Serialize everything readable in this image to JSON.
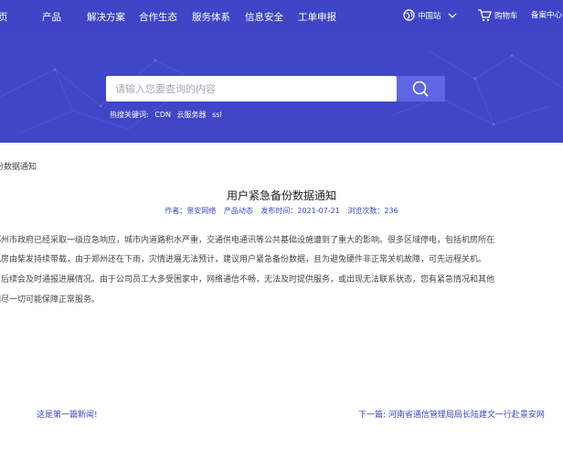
{
  "nav": {
    "items": [
      "页",
      "产品",
      "解决方案",
      "合作生态",
      "服务体系",
      "信息安全",
      "工单申报"
    ],
    "region": "中国站",
    "cart": "购物车",
    "filing": "备案中心"
  },
  "search": {
    "placeholder": "请输入您要查询的内容",
    "hot_label": "热搜关键词:",
    "hot_keywords": [
      "CDN",
      "云服务器",
      "ssl"
    ]
  },
  "breadcrumb": "份数据通知",
  "article": {
    "title": "用户紧急备份数据通知",
    "meta": {
      "author": "作者：景安网络",
      "category": "产品动态",
      "published": "发布时间：2021-07-21",
      "views": "浏览次数：236"
    },
    "lines": [
      "郑州市政府已经采取一级应急响应，城市内道路积水严重，交通供电通讯等公共基础设施遭到了重大的影响。很多区域停电，包括机房所在",
      "机房由柴发持续带载，由于郑州还在下雨，灾情进展无法预计，建议用户紧急备份数据，且为避免硬件非正常关机故障，可先远程关机。",
      "，后续会及时通报进展情况。由于公司员工大多受困家中，网络通信不畅，无法及时提供服务，或出现无法联系状态，您有紧急情况和其他",
      "们尽一切可能保障正常服务。"
    ]
  },
  "pager": {
    "prev": "这是第一篇新闻!",
    "next_label": "下一篇:",
    "next_title": "河南省通信管理局局长陆建文一行赴景安网"
  },
  "colors": {
    "nav_bg": "#3e45c6",
    "hero_bg": "#3f46c8",
    "search_button": "#5f66e6",
    "link": "#3e45c6"
  }
}
